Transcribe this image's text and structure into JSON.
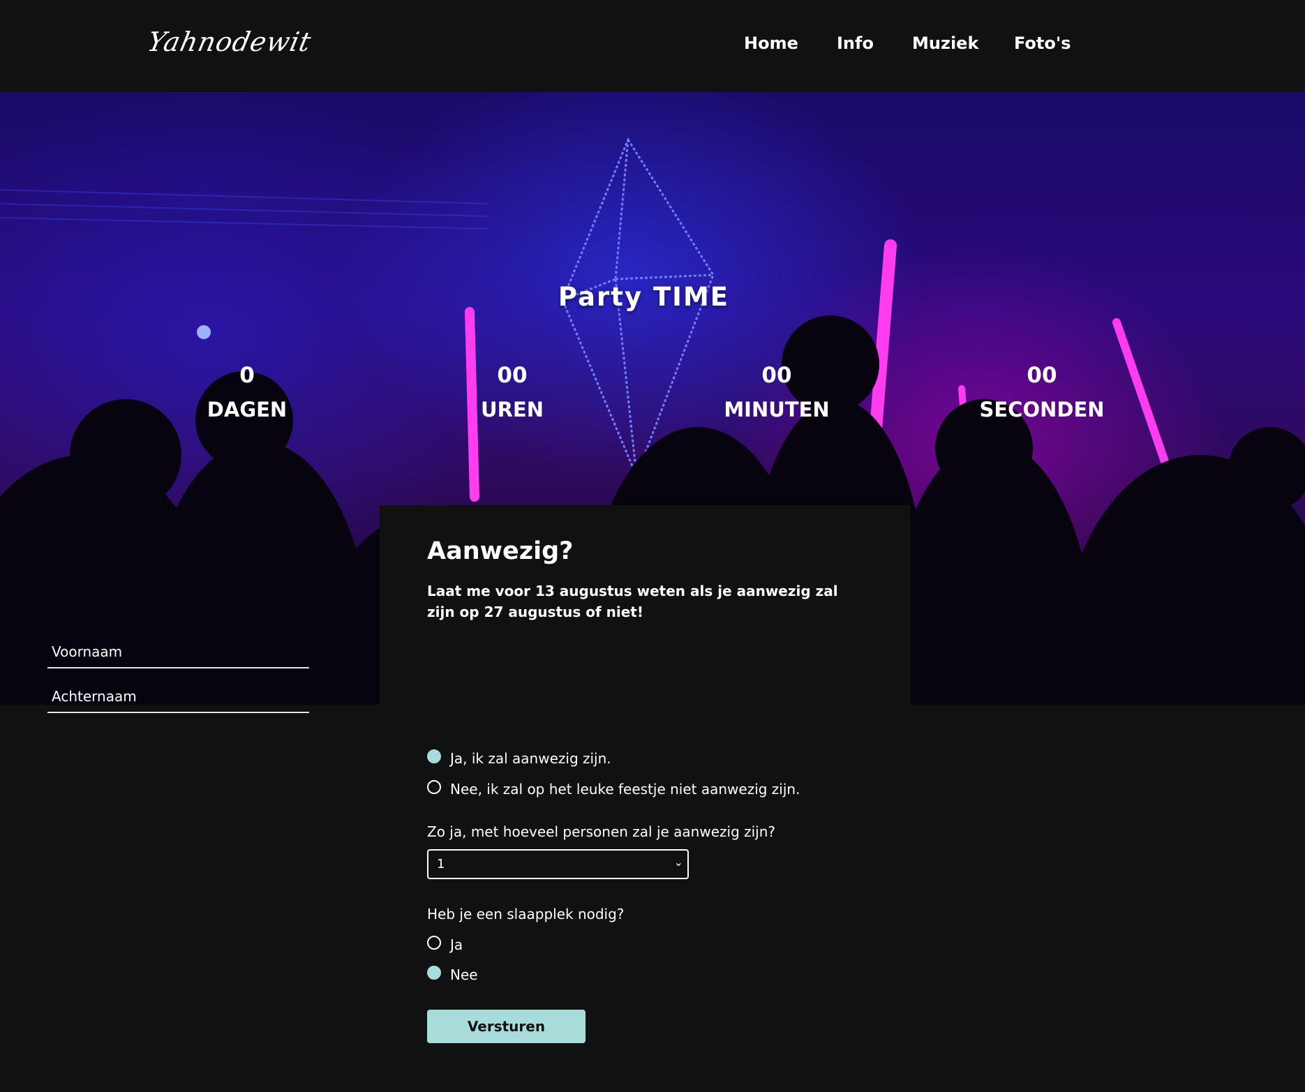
{
  "header": {
    "logo": "Yahnodewit",
    "nav": [
      {
        "label": "Home"
      },
      {
        "label": "Info"
      },
      {
        "label": "Muziek"
      },
      {
        "label": "Foto's"
      }
    ]
  },
  "hero": {
    "title": "Party TIME",
    "countdown": [
      {
        "value": "0",
        "label": "DAGEN"
      },
      {
        "value": "00",
        "label": "UREN"
      },
      {
        "value": "00",
        "label": "MINUTEN"
      },
      {
        "value": "00",
        "label": "SECONDEN"
      }
    ]
  },
  "form": {
    "title": "Aanwezig?",
    "intro": "Laat me voor 13 augustus weten als je aanwezig zal zijn op 27 augustus of niet!",
    "first_name_placeholder": "Voornaam",
    "last_name_placeholder": "Achternaam",
    "attendance": [
      {
        "label": "Ja, ik zal aanwezig zijn.",
        "checked": true
      },
      {
        "label": "Nee, ik zal op het leuke feestje niet aanwezig zijn.",
        "checked": false
      }
    ],
    "persons_question": "Zo ja, met hoeveel personen zal je aanwezig zijn?",
    "persons_selected": "1",
    "sleep_question": "Heb je een slaapplek nodig?",
    "sleep_options": [
      {
        "label": "Ja",
        "checked": false
      },
      {
        "label": "Nee",
        "checked": true
      }
    ],
    "submit_label": "Versturen"
  },
  "colors": {
    "background": "#111111",
    "accent": "#a8dcdb",
    "text": "#ffffff"
  },
  "icons": {
    "select_arrow": "chevron-down-icon"
  }
}
